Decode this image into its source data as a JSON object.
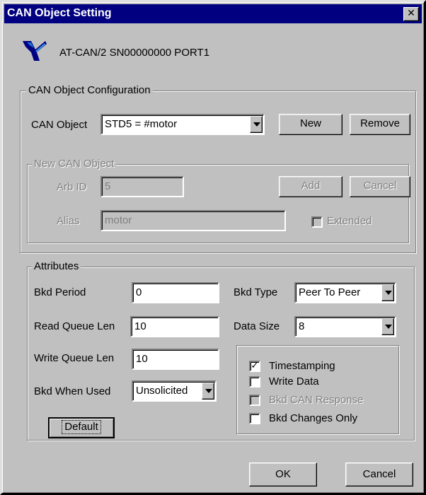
{
  "window": {
    "title": "CAN Object Setting",
    "close_glyph": "✕"
  },
  "header": {
    "device": "AT-CAN/2  SN00000000  PORT1"
  },
  "config": {
    "group_label": "CAN Object Configuration",
    "object_label": "CAN Object",
    "object_value": "STD5 = #motor",
    "new_label": "New",
    "remove_label": "Remove"
  },
  "new_object": {
    "group_label": "New CAN Object",
    "arbid_label": "Arb ID",
    "arbid_value": "5",
    "add_label": "Add",
    "cancel_label": "Cancel",
    "alias_label": "Alias",
    "alias_value": "motor",
    "extended_label": "Extended",
    "extended_checked": false
  },
  "attributes": {
    "group_label": "Attributes",
    "bkd_period_label": "Bkd Period",
    "bkd_period_value": "0",
    "read_queue_label": "Read Queue Len",
    "read_queue_value": "10",
    "write_queue_label": "Write Queue Len",
    "write_queue_value": "10",
    "bkd_when_used_label": "Bkd When Used",
    "bkd_when_used_value": "Unsolicited",
    "bkd_type_label": "Bkd Type",
    "bkd_type_value": "Peer To Peer",
    "data_size_label": "Data Size",
    "data_size_value": "8",
    "default_label": "Default",
    "options": [
      {
        "label": "Timestamping",
        "checked": true,
        "disabled": false
      },
      {
        "label": "Write Data",
        "checked": false,
        "disabled": false
      },
      {
        "label": "Bkd CAN Response",
        "checked": false,
        "disabled": true
      },
      {
        "label": "Bkd Changes Only",
        "checked": false,
        "disabled": false
      }
    ]
  },
  "footer": {
    "ok_label": "OK",
    "cancel_label": "Cancel"
  },
  "icons": {
    "logo": "ni-eagle-icon",
    "checkmark": "✓"
  },
  "colors": {
    "title_bar": "#000080",
    "face": "#c0c0c0",
    "disabled_text": "#808080"
  }
}
